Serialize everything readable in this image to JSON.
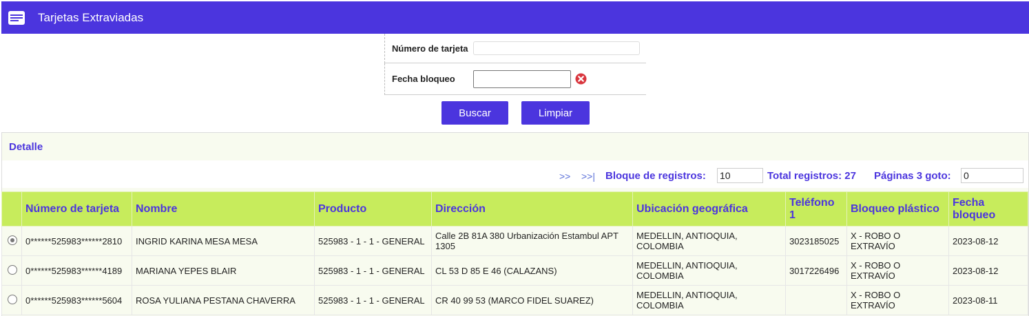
{
  "header": {
    "title": "Tarjetas Extraviadas",
    "icon": "card-list-icon"
  },
  "form": {
    "card_label": "Número de tarjeta",
    "card_value": "",
    "date_label": "Fecha bloqueo",
    "date_value": "",
    "search_button": "Buscar",
    "clear_button": "Limpiar"
  },
  "detail": {
    "title": "Detalle",
    "pager": {
      "next": ">>",
      "last": ">>|",
      "block_label": "Bloque de registros:",
      "block_value": "10",
      "total_label": "Total registros: 27",
      "pages_label": "Páginas 3 goto:",
      "goto_value": "0"
    },
    "columns": [
      "Número de tarjeta",
      "Nombre",
      "Producto",
      "Dirección",
      "Ubicación geográfica",
      "Teléfono 1",
      "Bloqueo plástico",
      "Fecha bloqueo"
    ],
    "rows": [
      {
        "selected": true,
        "card": "0******525983******2810",
        "name": "INGRID KARINA MESA MESA",
        "product": "525983 - 1 - 1 - GENERAL",
        "address": "Calle 2B 81A 380 Urbanización Estambul APT 1305",
        "location": "MEDELLIN, ANTIOQUIA, COLOMBIA",
        "phone": "3023185025",
        "block": "X - ROBO O EXTRAVÍO",
        "date": "2023-08-12"
      },
      {
        "selected": false,
        "card": "0******525983******4189",
        "name": "MARIANA YEPES BLAIR",
        "product": "525983 - 1 - 1 - GENERAL",
        "address": "CL 53 D 85 E 46 (CALAZANS)",
        "location": "MEDELLIN, ANTIOQUIA, COLOMBIA",
        "phone": "3017226496",
        "block": "X - ROBO O EXTRAVÍO",
        "date": "2023-08-12"
      },
      {
        "selected": false,
        "card": "0******525983******5604",
        "name": "ROSA YULIANA PESTANA CHAVERRA",
        "product": "525983 - 1 - 1 - GENERAL",
        "address": "CR 40 99 53 (MARCO FIDEL SUAREZ)",
        "location": "MEDELLIN, ANTIOQUIA, COLOMBIA",
        "phone": "",
        "block": "X - ROBO O EXTRAVÍO",
        "date": "2023-08-11"
      }
    ]
  },
  "colors": {
    "primary": "#4b35de",
    "header_row": "#c7ec5c",
    "panel_bg": "#f8fbef"
  }
}
